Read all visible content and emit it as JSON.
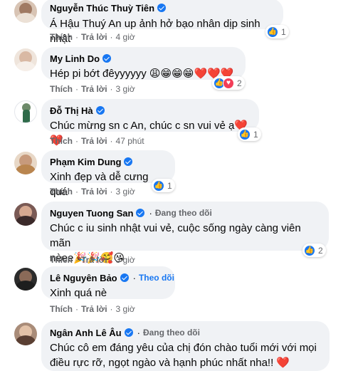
{
  "colors": {
    "accent": "#1877f2",
    "bubble": "#f0f2f5",
    "meta": "#65676b",
    "heart": "#e41e3f"
  },
  "icons": {
    "verified": "verified-badge-icon",
    "like": "like-reaction-icon",
    "love": "love-reaction-icon"
  },
  "comments": [
    {
      "author": "Nguyễn Thúc Thuỳ Tiên",
      "text": "Á Hậu Thuý An up ảnh hở bạo nhân dịp sinh nhật",
      "like": "Thích",
      "reply": "Trả lời",
      "time": "4 giờ",
      "reaction_count": "1"
    },
    {
      "author": "My Linh Do",
      "text": "Hép pi bớt đêyyyyyy 😩😁😁😁❤️❤️❤️",
      "like": "Thích",
      "reply": "Trả lời",
      "time": "3 giờ",
      "reaction_count": "2"
    },
    {
      "author": "Đỗ Thị Hà",
      "text": "Chúc mừng sn c An, chúc c sn vui vẻ ạ❤️❤️",
      "like": "Thích",
      "reply": "Trả lời",
      "time": "47 phút",
      "reaction_count": "1"
    },
    {
      "author": "Phạm Kim Dung",
      "text": "Xinh đẹp và dễ cưng quá",
      "like": "Thích",
      "reply": "Trả lời",
      "time": "3 giờ",
      "reaction_count": "1"
    },
    {
      "author": "Nguyen Tuong San",
      "follow": "Đang theo dõi",
      "text_line1": "Chúc c iu sinh nhật vui vẻ, cuộc sống ngày càng viên mãn",
      "text_line2": "nèee🎉🎉🥰😘",
      "like": "Thích",
      "reply": "Trả lời",
      "time": "3 giờ",
      "reaction_count": "2"
    },
    {
      "author": "Lê Nguyên Bảo",
      "follow": "Theo dõi",
      "text": "Xinh quá nè",
      "like": "Thích",
      "reply": "Trả lời",
      "time": "3 giờ"
    },
    {
      "author": "Ngân Anh Lê Âu",
      "follow": "Đang theo dõi",
      "text_line1": "Chúc cô em đáng yêu của chị đón chào tuổi mới với mọi",
      "text_line2": "điều rực rỡ, ngọt ngào và hạnh phúc nhất nha!! ❤️"
    }
  ]
}
